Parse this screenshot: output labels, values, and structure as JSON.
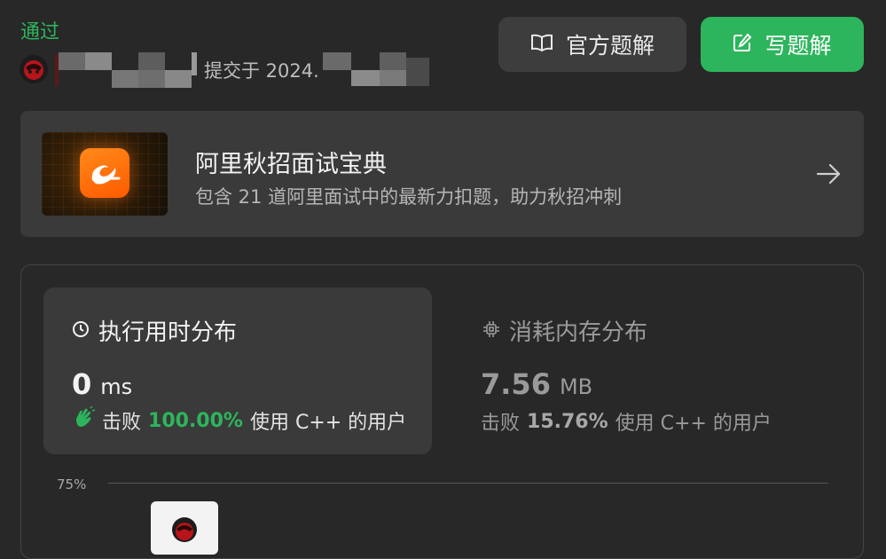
{
  "result": {
    "status": "通过",
    "submitted_prefix": "提交于 2024."
  },
  "buttons": {
    "official": "官方题解",
    "write": "写题解"
  },
  "banner": {
    "title": "阿里秋招面试宝典",
    "subtitle": "包含 21 道阿里面试中的最新力扣题，助力秋招冲刺"
  },
  "runtime": {
    "title": "执行用时分布",
    "value": "0",
    "unit": "ms",
    "beat_label": "击败",
    "beat_pct": "100.00%",
    "beat_suffix": "使用 C++ 的用户"
  },
  "memory": {
    "title": "消耗内存分布",
    "value": "7.56",
    "unit": "MB",
    "beat_label": "击败",
    "beat_pct": "15.76%",
    "beat_suffix": "使用 C++ 的用户"
  },
  "chart": {
    "axis_label": "75%"
  },
  "colors": {
    "accent": "#2db55d",
    "background": "#282828",
    "card": "#3a3a3a"
  },
  "icons": [
    "book-icon",
    "edit-icon",
    "arrow-right-icon",
    "clock-icon",
    "chip-icon",
    "clap-icon",
    "alibaba-logo",
    "user-avatar"
  ]
}
